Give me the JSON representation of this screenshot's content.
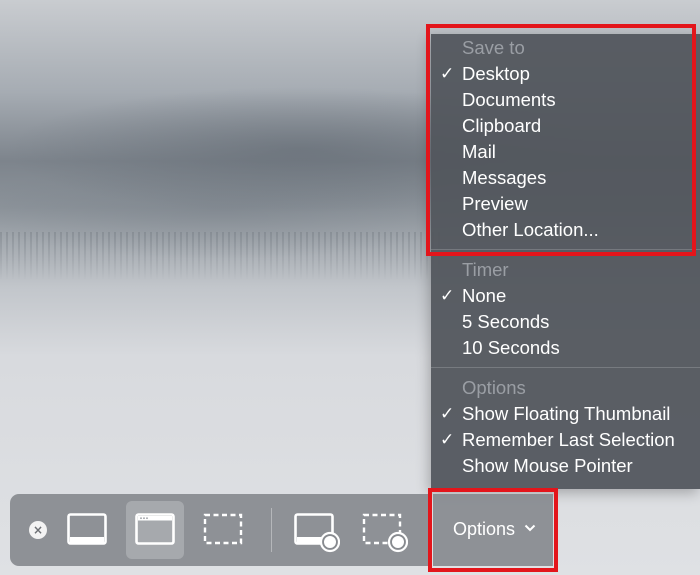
{
  "menu": {
    "save_to": {
      "header": "Save to",
      "items": [
        {
          "label": "Desktop",
          "checked": true
        },
        {
          "label": "Documents",
          "checked": false
        },
        {
          "label": "Clipboard",
          "checked": false
        },
        {
          "label": "Mail",
          "checked": false
        },
        {
          "label": "Messages",
          "checked": false
        },
        {
          "label": "Preview",
          "checked": false
        },
        {
          "label": "Other Location...",
          "checked": false
        }
      ]
    },
    "timer": {
      "header": "Timer",
      "items": [
        {
          "label": "None",
          "checked": true
        },
        {
          "label": "5 Seconds",
          "checked": false
        },
        {
          "label": "10 Seconds",
          "checked": false
        }
      ]
    },
    "options": {
      "header": "Options",
      "items": [
        {
          "label": "Show Floating Thumbnail",
          "checked": true
        },
        {
          "label": "Remember Last Selection",
          "checked": true
        },
        {
          "label": "Show Mouse Pointer",
          "checked": false
        }
      ]
    },
    "check_glyph": "✓"
  },
  "toolbar": {
    "close_glyph": "×",
    "buttons": [
      {
        "icon": "capture-entire-screen-icon"
      },
      {
        "icon": "capture-selected-window-icon",
        "selected": true
      },
      {
        "icon": "capture-selected-portion-icon"
      },
      {
        "icon": "record-entire-screen-icon"
      },
      {
        "icon": "record-selected-portion-icon"
      }
    ],
    "options_label": "Options"
  },
  "colors": {
    "highlight": "#e3151b",
    "menu_bg": "#52565c",
    "toolbar_bg": "#878a8f"
  }
}
